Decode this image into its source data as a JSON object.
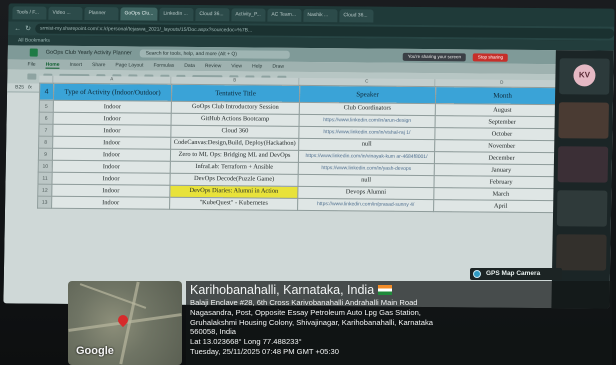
{
  "browser": {
    "tabs": [
      "Tools / F...",
      "Video ...",
      "Planner",
      "GoOps Clu...",
      "LinkedIn ...",
      "Cloud 36...",
      "Activity_P...",
      "AC Team...",
      "Nashik ...",
      "Cloud 36..."
    ],
    "active_tab": 3,
    "url": "srmist-my.sharepoint.com/:x:/r/personal/tejaswa_2021/_layouts/15/Doc.aspx?sourcedoc=%7B...",
    "bookmarks": "All Bookmarks"
  },
  "excel": {
    "file_title": "GoOps Club Yearly Activity Planner",
    "search_placeholder": "Search for tools, help, and more (Alt + Q)",
    "sharing_label": "You're sharing your screen",
    "stop_sharing_label": "Stop sharing",
    "menu": [
      "File",
      "Home",
      "Insert",
      "Share",
      "Page Layout",
      "Formulas",
      "Data",
      "Review",
      "View",
      "Help",
      "Draw"
    ],
    "active_menu": 1,
    "fx_cell": "B25",
    "columns": [
      "A",
      "B",
      "C",
      "D",
      "E"
    ],
    "headers": {
      "row_num": "4",
      "type": "Type of Activity (Indoor/Outdoor)",
      "title": "Tentative Title",
      "speaker": "Speaker",
      "month": "Month"
    },
    "rows": [
      {
        "n": "5",
        "type": "Indoor",
        "title": "GoOps Club Introductory Session",
        "speaker": "Club Coordinators",
        "month": "August",
        "link": false,
        "hl": false
      },
      {
        "n": "6",
        "type": "Indoor",
        "title": "GitHub Actions Bootcamp",
        "speaker": "https://www.linkedin.com/in/arun-design",
        "month": "September",
        "link": true,
        "hl": false
      },
      {
        "n": "7",
        "type": "Indoor",
        "title": "Cloud 360",
        "speaker": "https://www.linkedin.com/in/vishal-raj 1/",
        "month": "October",
        "link": true,
        "hl": false
      },
      {
        "n": "8",
        "type": "Indoor",
        "title": "CodeCanvas:Design,Build, Deploy(Hackathon)",
        "speaker": "null",
        "month": "November",
        "link": false,
        "hl": false
      },
      {
        "n": "9",
        "type": "Indoor",
        "title": "Zero to ML Ops: Bridging ML and DevOps",
        "speaker": "https://www.linkedin.com/in/vinayak-kum ar-4684f8001/",
        "month": "December",
        "link": true,
        "hl": false
      },
      {
        "n": "10",
        "type": "Indoor",
        "title": "InfraLab: Terraform + Ansible",
        "speaker": "https://www.linkedin.com/in/yash-devops",
        "month": "January",
        "link": true,
        "hl": false
      },
      {
        "n": "11",
        "type": "Indoor",
        "title": "DevOps Decode(Puzzle Game)",
        "speaker": "null",
        "month": "February",
        "link": false,
        "hl": false
      },
      {
        "n": "12",
        "type": "Indoor",
        "title": "DevOps Diaries: Alumni in Action",
        "speaker": "Devops Alumni",
        "month": "March",
        "link": false,
        "hl": true
      },
      {
        "n": "13",
        "type": "Indoor",
        "title": "\"KubeQuest\" - Kubernetes",
        "speaker": "https://www.linkedin.com/in/prasad-sunny 4/",
        "month": "April",
        "link": true,
        "hl": false
      }
    ]
  },
  "meeting": {
    "avatar_initials": "KV"
  },
  "gps_camera": {
    "brand": "GPS Map Camera",
    "map_label": "Google",
    "place": "Karihobanahalli, Karnataka, India",
    "address_lines": [
      "Balaji Enclave #28, 6th Cross Karivobanahalli Andrahalli Main Road",
      "Nagasandra, Post, Opposite Essay Petroleum Auto Lpg Gas Station,",
      "Gruhalakshmi Housing Colony, Shivajinagar, Karihobanahalli, Karnataka",
      "560058, India"
    ],
    "coords": "Lat 13.023668° Long 77.488233°",
    "datetime": "Tuesday, 25/11/2025 07:48 PM GMT +05:30"
  }
}
